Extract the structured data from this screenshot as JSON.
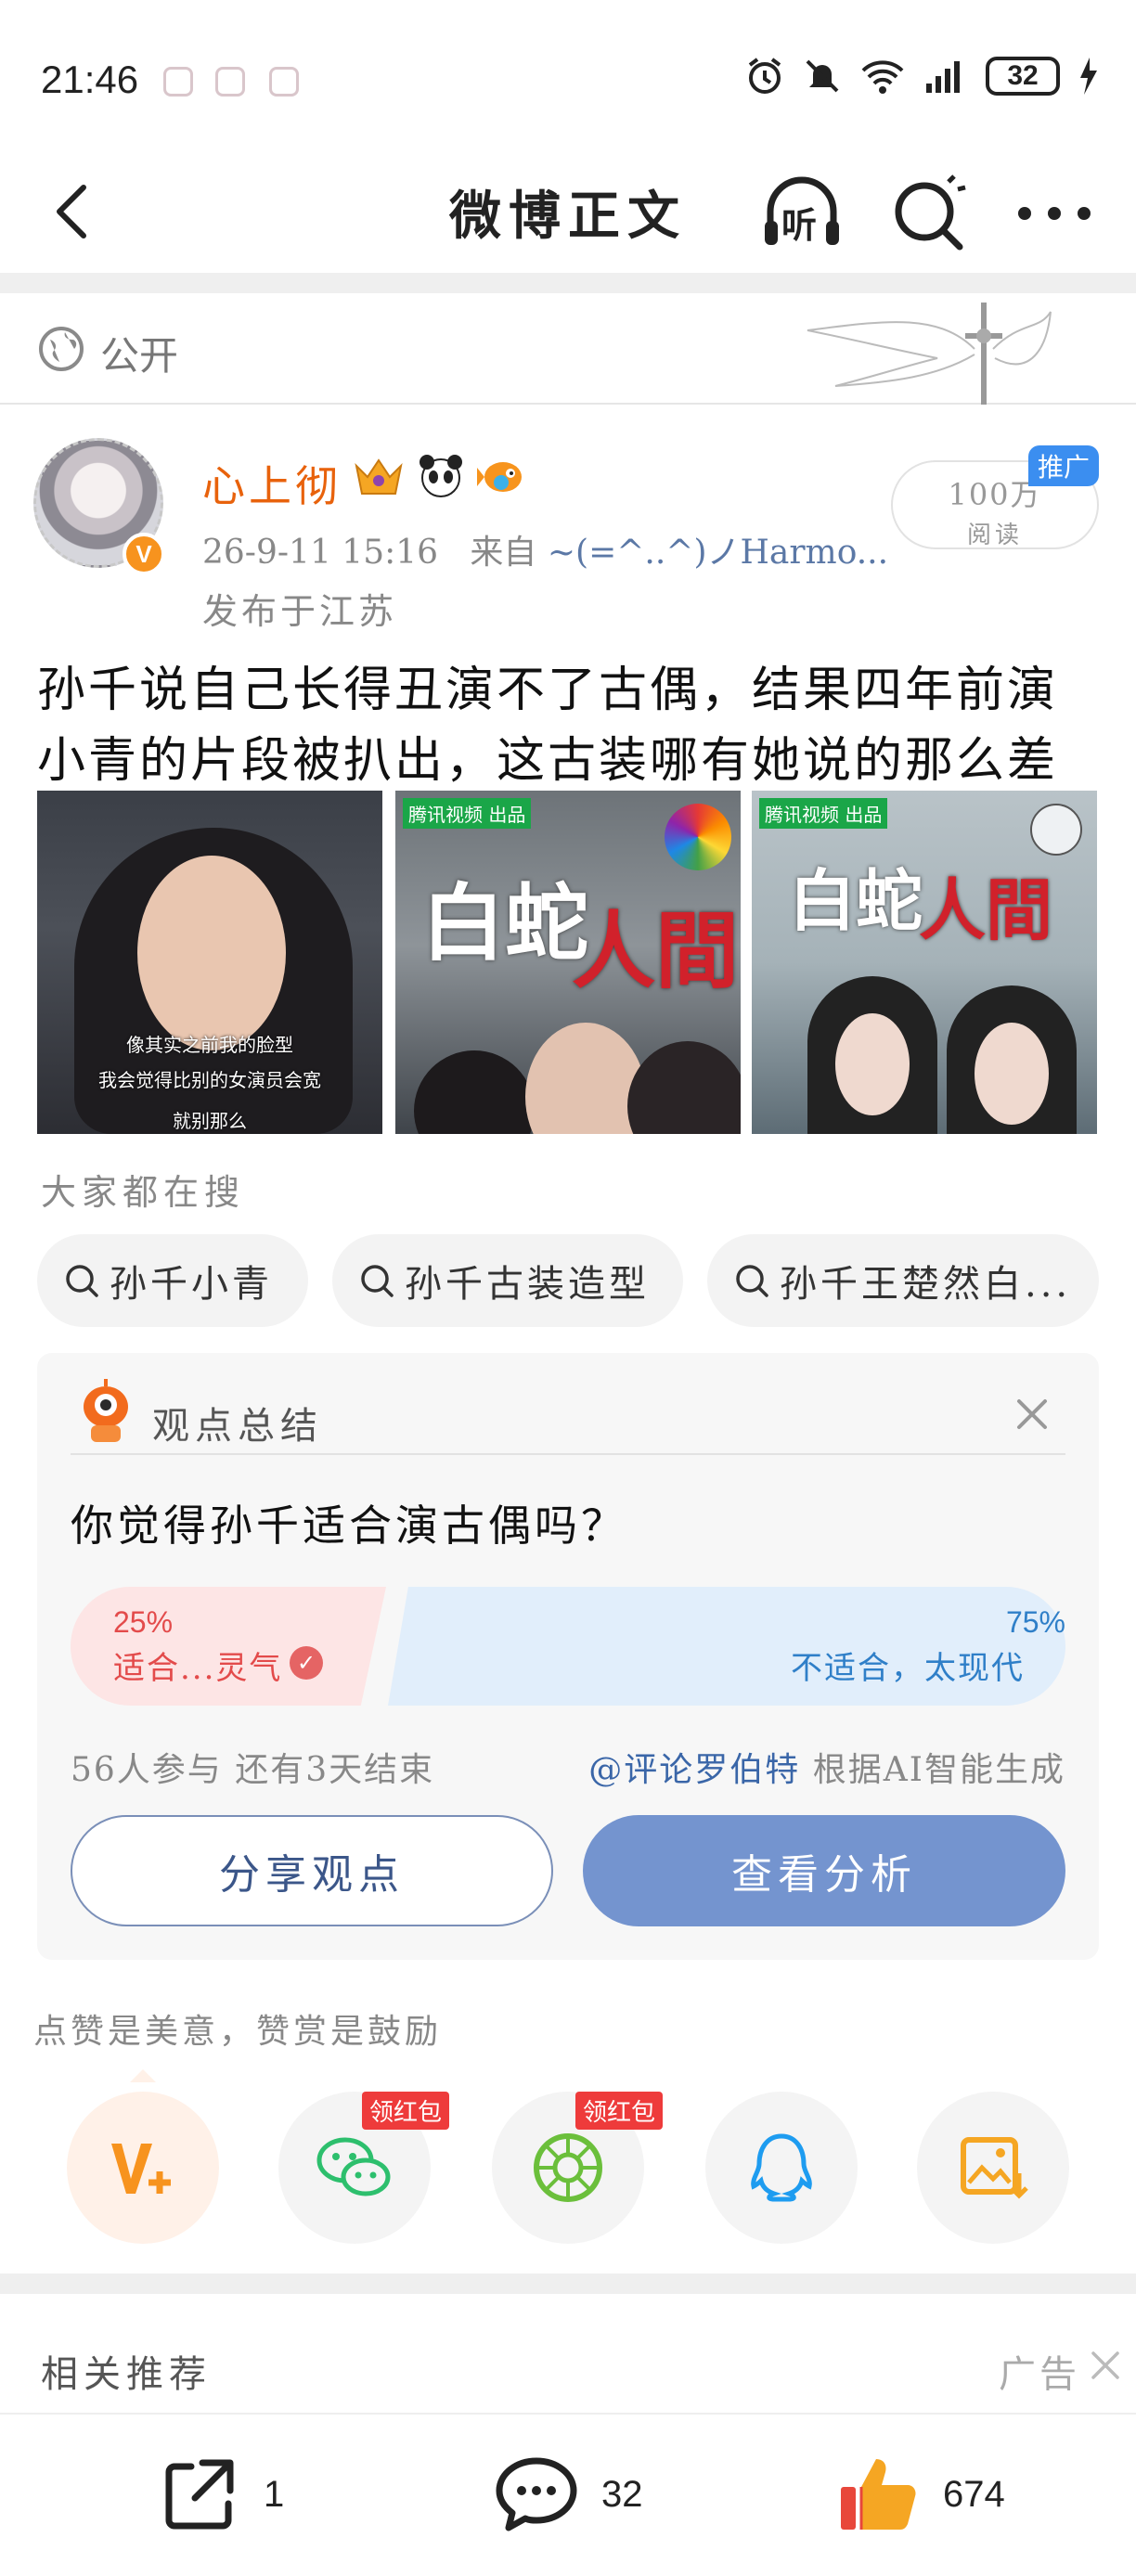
{
  "status_bar": {
    "time": "21:46",
    "battery": "32"
  },
  "nav": {
    "title": "微博正文",
    "listen_label": "听"
  },
  "visibility": {
    "label": "公开"
  },
  "post": {
    "author": "心上彻",
    "meta_time": "26-9-11 15:16",
    "meta_from": "来自",
    "meta_source": "~(=^..^)ノHarmo...",
    "location": "发布于江苏",
    "reads_value": "100万",
    "reads_label": "阅读",
    "promo_badge": "推广",
    "text": "孙千说自己长得丑演不了古偶，结果四年前演小青的片段被扒出，这古装哪有她说的那么差啊",
    "images": [
      {
        "caption_lines": [
          "像其实之前我的脸型",
          "我会觉得比别的女演员会宽",
          "就别那么"
        ]
      },
      {
        "tag": "腾讯视频 出品",
        "poster_title": "白蛇",
        "poster_title_red": "人間"
      },
      {
        "tag": "腾讯视频 出品",
        "poster_title": "白蛇",
        "poster_title_red": "人間"
      }
    ]
  },
  "searches": {
    "title": "大家都在搜",
    "items": [
      "孙千小青",
      "孙千古装造型",
      "孙千王楚然白..."
    ]
  },
  "opinion": {
    "header": "观点总结",
    "question": "你觉得孙千适合演古偶吗？",
    "option_a": {
      "percent": "25%",
      "label": "适合...灵气"
    },
    "option_b": {
      "percent": "75%",
      "label": "不适合，太现代"
    },
    "participation": "56人参与  还有3天结束",
    "ai_author": "@评论罗伯特",
    "ai_note": "根据AI智能生成",
    "share_button": "分享观点",
    "view_button": "查看分析"
  },
  "reward": {
    "title": "点赞是美意，赞赏是鼓励",
    "red_packet_badge": "领红包",
    "icons": [
      "vplus-icon",
      "wechat-icon",
      "moments-icon",
      "qq-icon",
      "save-image-icon"
    ]
  },
  "related": {
    "title": "相关推荐",
    "ad_label": "广告"
  },
  "actions": {
    "share_count": "1",
    "comment_count": "32",
    "like_count": "674"
  }
}
